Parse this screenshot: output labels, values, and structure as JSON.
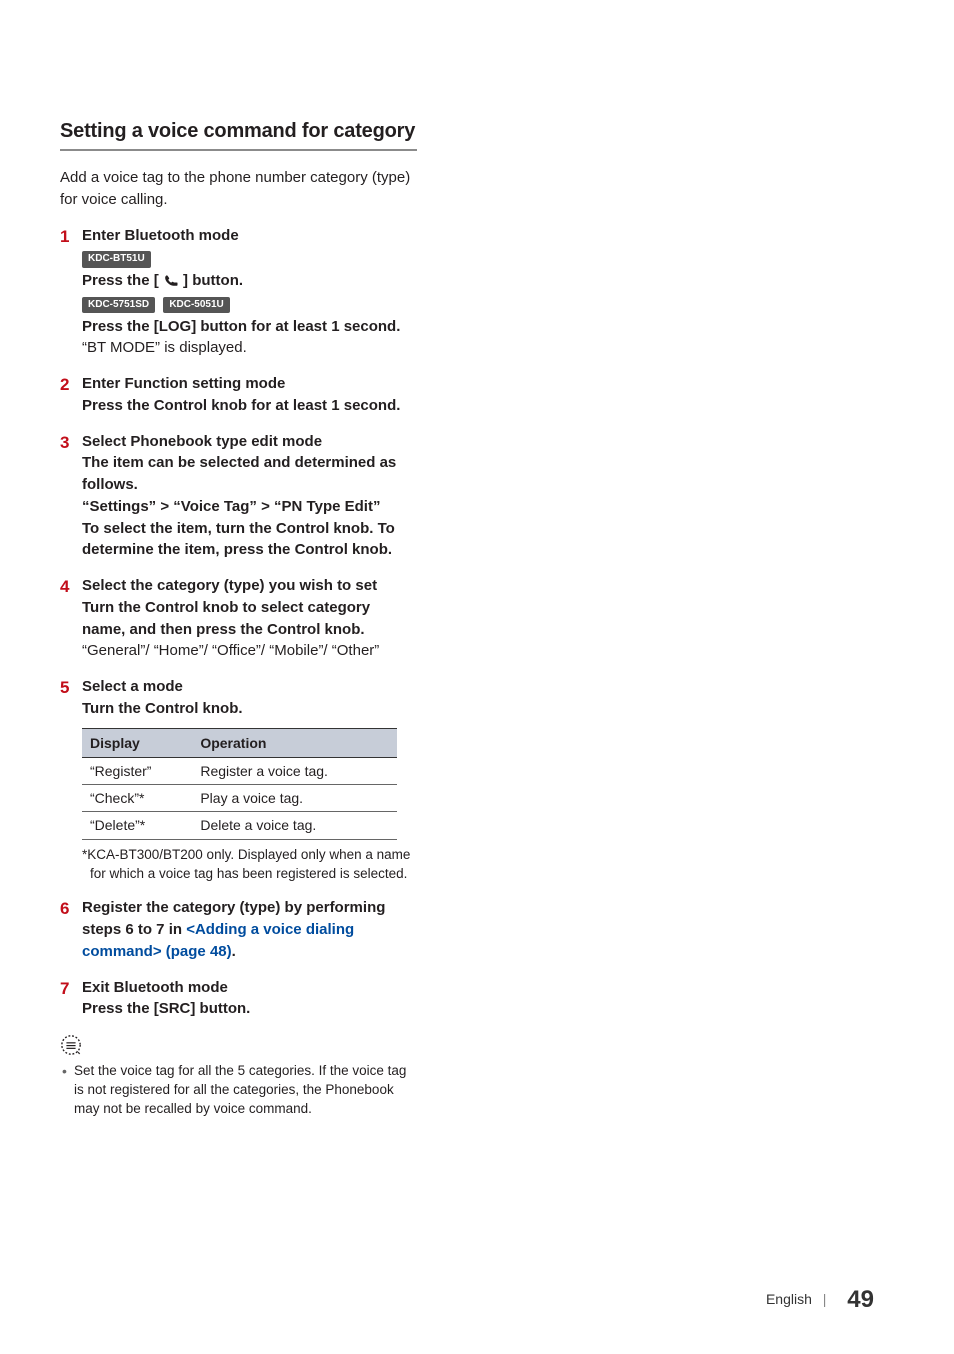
{
  "section_title": "Setting a voice command for category",
  "intro": "Add a voice tag to the phone number category (type) for voice calling.",
  "steps": {
    "s1": {
      "title": "Enter Bluetooth mode",
      "badge1": "KDC-BT51U",
      "line1a": "Press the [ ",
      "line1b": " ] button.",
      "badge2a": "KDC-5751SD",
      "badge2b": "KDC-5051U",
      "line2": "Press the [LOG] button for at least 1 second.",
      "line3": "“BT MODE” is displayed."
    },
    "s2": {
      "title": "Enter Function setting mode",
      "line1": "Press the Control knob for at least 1 second."
    },
    "s3": {
      "title": "Select Phonebook type edit mode",
      "line1": "The item can be selected and determined as follows.",
      "path_a": "“Settings”",
      "path_b": "“Voice Tag”",
      "path_c": "“PN Type Edit”",
      "line3": "To select the item, turn the Control knob. To determine the item, press the Control knob."
    },
    "s4": {
      "title": "Select the category (type) you wish to set",
      "line1": "Turn the Control knob to select category name, and then press the Control knob.",
      "line2": "“General”/ “Home”/ “Office”/ “Mobile”/ “Other”"
    },
    "s5": {
      "title": "Select a mode",
      "line1": "Turn the Control knob.",
      "table": {
        "h1": "Display",
        "h2": "Operation",
        "rows": [
          {
            "d": "“Register”",
            "o": "Register a voice tag."
          },
          {
            "d": "“Check”*",
            "o": "Play a voice tag."
          },
          {
            "d": "“Delete”*",
            "o": "Delete a voice tag."
          }
        ]
      },
      "footnote": "*KCA-BT300/BT200 only. Displayed only when a name for which a voice tag has been registered is selected."
    },
    "s6": {
      "pre": "Register the category (type) by performing steps 6 to 7 in ",
      "link": "<Adding a voice dialing command> (page 48)",
      "post": "."
    },
    "s7": {
      "title": "Exit Bluetooth mode",
      "line1": "Press the [SRC] button."
    }
  },
  "note": "Set the voice tag for all the 5 categories.  If the voice tag is not registered for all the categories, the Phonebook may not be recalled by voice command.",
  "footer": {
    "lang": "English",
    "page": "49"
  }
}
